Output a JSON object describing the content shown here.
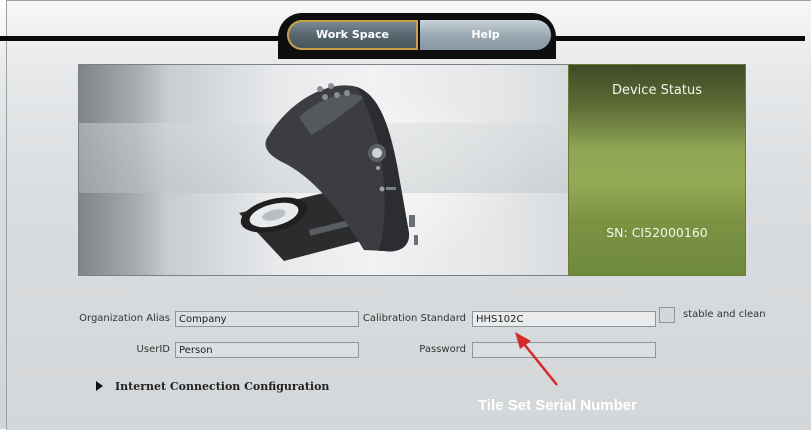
{
  "tabs": {
    "workspace": "Work Space",
    "help": "Help"
  },
  "device_status": {
    "title": "Device Status",
    "serial": "SN: CI52000160"
  },
  "form": {
    "org_alias_label": "Organization Alias",
    "org_alias_value": "Company",
    "userid_label": "UserID",
    "userid_value": "Person",
    "calibration_label": "Calibration Standard",
    "calibration_value": "HHS102C",
    "password_label": "Password",
    "password_value": "",
    "stable_label": "stable and clean",
    "connection_label": "Internet Connection Configuration"
  },
  "annotation": {
    "text": "Tile Set Serial Number",
    "color": "#d42a2a"
  },
  "colors": {
    "status_green": "#8ea554",
    "active_tab_outline": "#c8a04a"
  }
}
